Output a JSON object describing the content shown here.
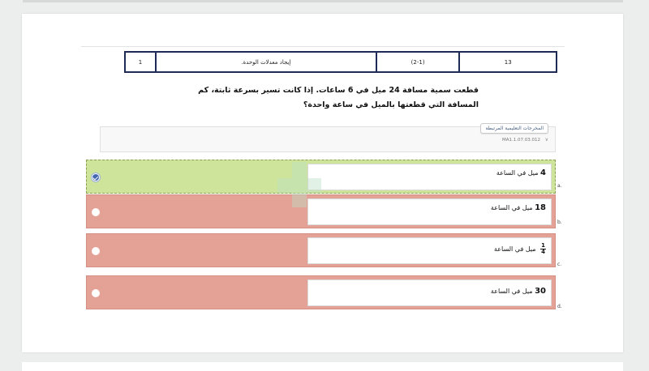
{
  "header_table": {
    "cells": [
      "1",
      "إيجاد معدلات الوحدة.",
      "(2-1)",
      "13"
    ]
  },
  "question": {
    "text": "قطعت سمية مسافة 24 ميل في 6 ساعات. إذا كانت تسير بسرعة ثابتة، كم المسافة التي قطعتها بالميل في ساعة واحدة؟"
  },
  "standards": {
    "button_label": "المخرجات التعليمية المرتبطة",
    "code": "MA1.1.07.03.012"
  },
  "options": [
    {
      "letter": "a.",
      "value": "4",
      "unit": "ميل في الساعة",
      "state": "correct",
      "selected": true
    },
    {
      "letter": "b.",
      "value": "18",
      "unit": "ميل في الساعة",
      "state": "wrong",
      "selected": false
    },
    {
      "letter": "c.",
      "numerator": "1",
      "denominator": "4",
      "unit": "ميل في الساعة",
      "state": "wrong",
      "selected": false
    },
    {
      "letter": "d.",
      "value": "30",
      "unit": "ميل في الساعة",
      "state": "wrong",
      "selected": false
    }
  ],
  "colors": {
    "correct_bg": "#cde49a",
    "wrong_bg": "#e4a195",
    "table_border": "#1f2b54",
    "radio_checked": "#4468b0"
  },
  "icons": {
    "selected_radio": "check-circle-icon",
    "standards_toggle": "chevron-down-icon"
  }
}
